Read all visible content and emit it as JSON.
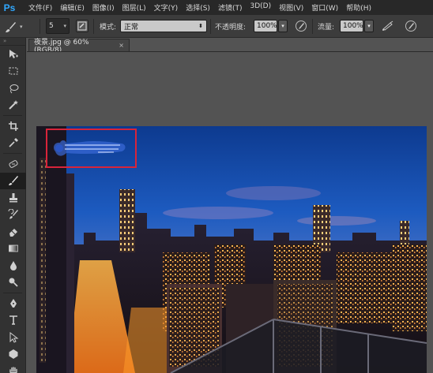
{
  "app": {
    "logo": "Ps",
    "menu": [
      "文件(F)",
      "编辑(E)",
      "图像(I)",
      "图层(L)",
      "文字(Y)",
      "选择(S)",
      "滤镜(T)",
      "3D(D)",
      "视图(V)",
      "窗口(W)",
      "帮助(H)"
    ]
  },
  "options": {
    "tool_icon": "brush-icon",
    "brush_size": "5",
    "mode_label": "模式:",
    "mode_value": "正常",
    "opacity_label": "不透明度:",
    "opacity_value": "100%",
    "flow_label": "流量:",
    "flow_value": "100%"
  },
  "document": {
    "tab_title": "夜景.jpg @ 60%(RGB/8)",
    "tab_close": "×"
  },
  "toolbar": {
    "grip": "»",
    "tools": [
      "move-tool-icon",
      "marquee-tool-icon",
      "lasso-tool-icon",
      "magic-wand-tool-icon",
      "crop-tool-icon",
      "eyedropper-tool-icon",
      "healing-brush-tool-icon",
      "brush-tool-icon",
      "clone-stamp-tool-icon",
      "history-brush-tool-icon",
      "eraser-tool-icon",
      "gradient-tool-icon",
      "blur-tool-icon",
      "dodge-tool-icon",
      "pen-tool-icon",
      "type-tool-icon",
      "path-selection-tool-icon",
      "shape-tool-icon",
      "hand-tool-icon"
    ],
    "active_tool": "brush-tool-icon"
  },
  "colors": {
    "menubar_bg": "#282828",
    "optionsbar_bg": "#3c3c3c",
    "workspace_bg": "#535353",
    "selection_outline": "#d8243a",
    "ps_accent": "#31a8ff"
  }
}
